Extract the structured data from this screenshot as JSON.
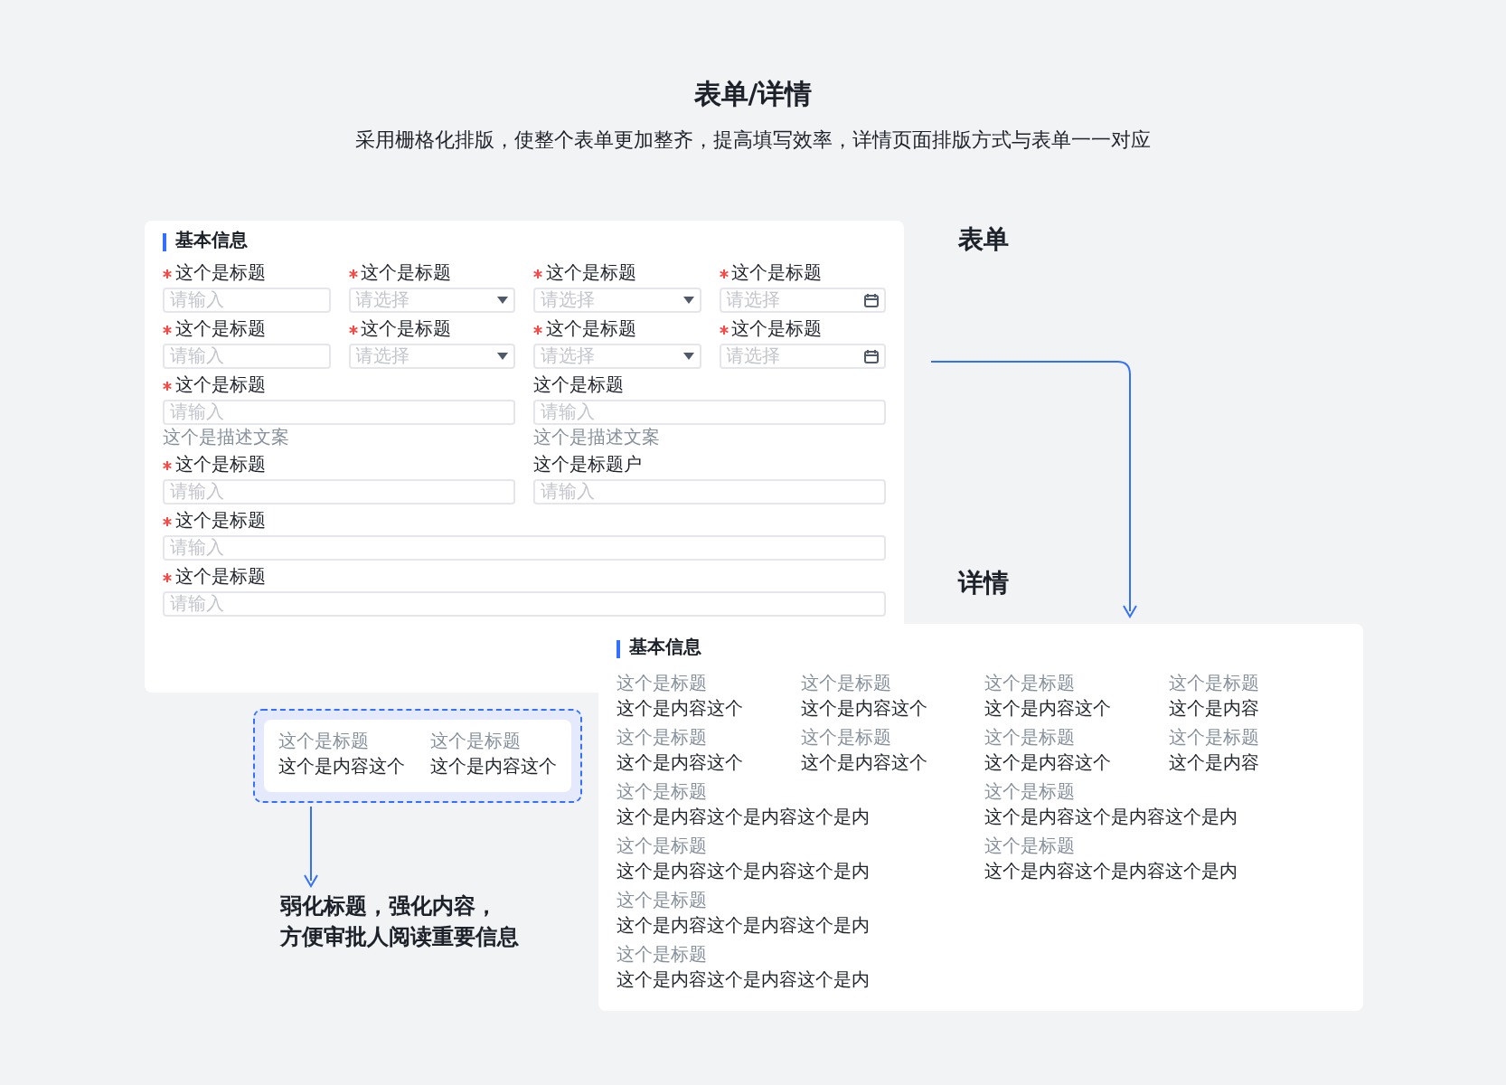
{
  "header": {
    "title": "表单/详情",
    "subtitle": "采用栅格化排版，使整个表单更加整齐，提高填写效率，详情页面排版方式与表单一一对应"
  },
  "form": {
    "label": "表单",
    "section_title": "基本信息",
    "rows": [
      [
        {
          "kind": "input",
          "label": "这个是标题",
          "required": true,
          "placeholder": "请输入"
        },
        {
          "kind": "select",
          "label": "这个是标题",
          "required": true,
          "placeholder": "请选择"
        },
        {
          "kind": "select",
          "label": "这个是标题",
          "required": true,
          "placeholder": "请选择"
        },
        {
          "kind": "date",
          "label": "这个是标题",
          "required": true,
          "placeholder": "请选择"
        }
      ],
      [
        {
          "kind": "input",
          "label": "这个是标题",
          "required": true,
          "placeholder": "请输入"
        },
        {
          "kind": "select",
          "label": "这个是标题",
          "required": true,
          "placeholder": "请选择"
        },
        {
          "kind": "select",
          "label": "这个是标题",
          "required": true,
          "placeholder": "请选择"
        },
        {
          "kind": "date",
          "label": "这个是标题",
          "required": true,
          "placeholder": "请选择"
        }
      ],
      [
        {
          "kind": "input",
          "label": "这个是标题",
          "required": true,
          "placeholder": "请输入",
          "hint": "这个是描述文案"
        },
        {
          "kind": "input",
          "label": "这个是标题",
          "required": false,
          "placeholder": "请输入",
          "hint": "这个是描述文案"
        }
      ],
      [
        {
          "kind": "input",
          "label": "这个是标题",
          "required": true,
          "placeholder": "请输入"
        },
        {
          "kind": "input",
          "label": "这个是标题户",
          "required": false,
          "placeholder": "请输入"
        }
      ],
      [
        {
          "kind": "input",
          "label": "这个是标题",
          "required": true,
          "placeholder": "请输入"
        }
      ],
      [
        {
          "kind": "input",
          "label": "这个是标题",
          "required": true,
          "placeholder": "请输入"
        }
      ]
    ]
  },
  "detail": {
    "label": "详情",
    "section_title": "基本信息",
    "short_rows": [
      [
        {
          "label": "这个是标题",
          "value": "这个是内容这个"
        },
        {
          "label": "这个是标题",
          "value": "这个是内容这个"
        },
        {
          "label": "这个是标题",
          "value": "这个是内容这个"
        },
        {
          "label": "这个是标题",
          "value": "这个是内容"
        }
      ],
      [
        {
          "label": "这个是标题",
          "value": "这个是内容这个"
        },
        {
          "label": "这个是标题",
          "value": "这个是内容这个"
        },
        {
          "label": "这个是标题",
          "value": "这个是内容这个"
        },
        {
          "label": "这个是标题",
          "value": "这个是内容"
        }
      ]
    ],
    "long_rows": [
      [
        {
          "label": "这个是标题",
          "value": "这个是内容这个是内容这个是内"
        },
        {
          "label": "这个是标题",
          "value": "这个是内容这个是内容这个是内"
        }
      ],
      [
        {
          "label": "这个是标题",
          "value": "这个是内容这个是内容这个是内"
        },
        {
          "label": "这个是标题",
          "value": "这个是内容这个是内容这个是内"
        }
      ],
      [
        {
          "label": "这个是标题",
          "value": "这个是内容这个是内容这个是内"
        }
      ],
      [
        {
          "label": "这个是标题",
          "value": "这个是内容这个是内容这个是内"
        }
      ]
    ]
  },
  "callout": {
    "items": [
      {
        "label": "这个是标题",
        "value": "这个是内容这个"
      },
      {
        "label": "这个是标题",
        "value": "这个是内容这个"
      }
    ],
    "caption_lines": [
      "弱化标题，强化内容，",
      "方便审批人阅读重要信息"
    ]
  }
}
